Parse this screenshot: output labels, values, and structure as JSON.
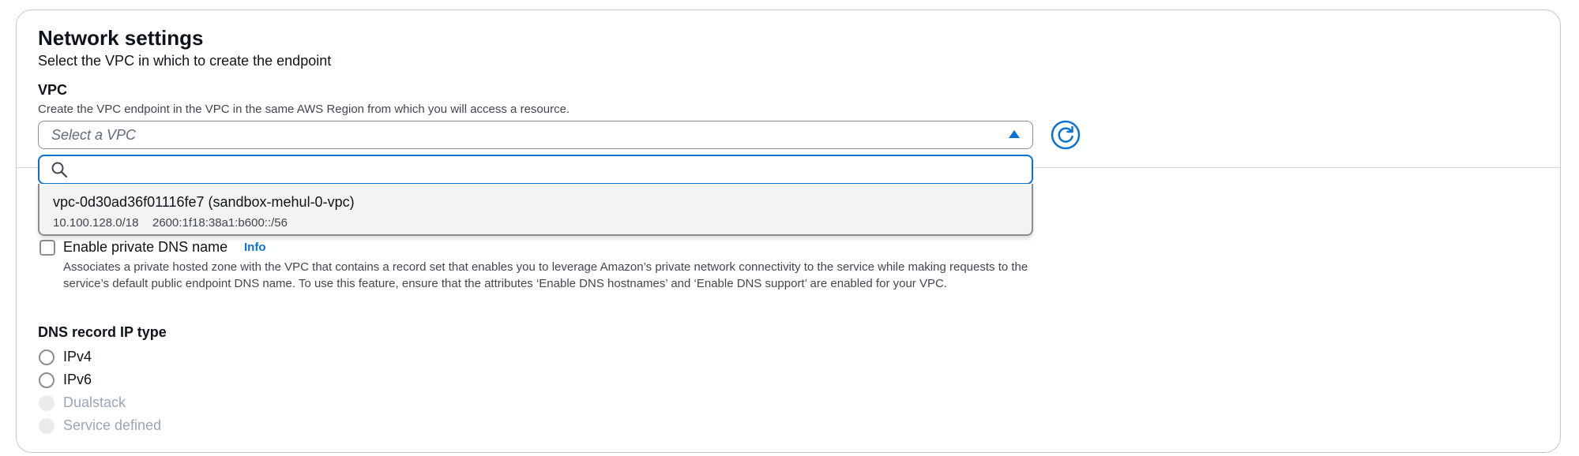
{
  "section": {
    "title": "Network settings",
    "subtitle": "Select the VPC in which to create the endpoint"
  },
  "vpc": {
    "label": "VPC",
    "description": "Create the VPC endpoint in the VPC in the same AWS Region from which you will access a resource.",
    "select_placeholder": "Select a VPC",
    "search_value": "",
    "options": [
      {
        "title": "vpc-0d30ad36f01116fe7 (sandbox-mehul-0-vpc)",
        "ipv4_cidr": "10.100.128.0/18",
        "ipv6_cidr": "2600:1f18:38a1:b600::/56"
      }
    ]
  },
  "private_dns": {
    "label": "Enable private DNS name",
    "info": "Info",
    "checked": false,
    "description": "Associates a private hosted zone with the VPC that contains a record set that enables you to leverage Amazon’s private network connectivity to the service while making requests to the service’s default public endpoint DNS name. To use this feature, ensure that the attributes ‘Enable DNS hostnames’ and ‘Enable DNS support’ are enabled for your VPC."
  },
  "dns_record_ip_type": {
    "label": "DNS record IP type",
    "options": [
      {
        "label": "IPv4",
        "disabled": false
      },
      {
        "label": "IPv6",
        "disabled": false
      },
      {
        "label": "Dualstack",
        "disabled": true
      },
      {
        "label": "Service defined",
        "disabled": true
      }
    ]
  },
  "colors": {
    "accent": "#0972d3",
    "border": "#8c8c94",
    "disabled_text": "#9ba7b6",
    "dropdown_bg": "#f2f3f3"
  }
}
